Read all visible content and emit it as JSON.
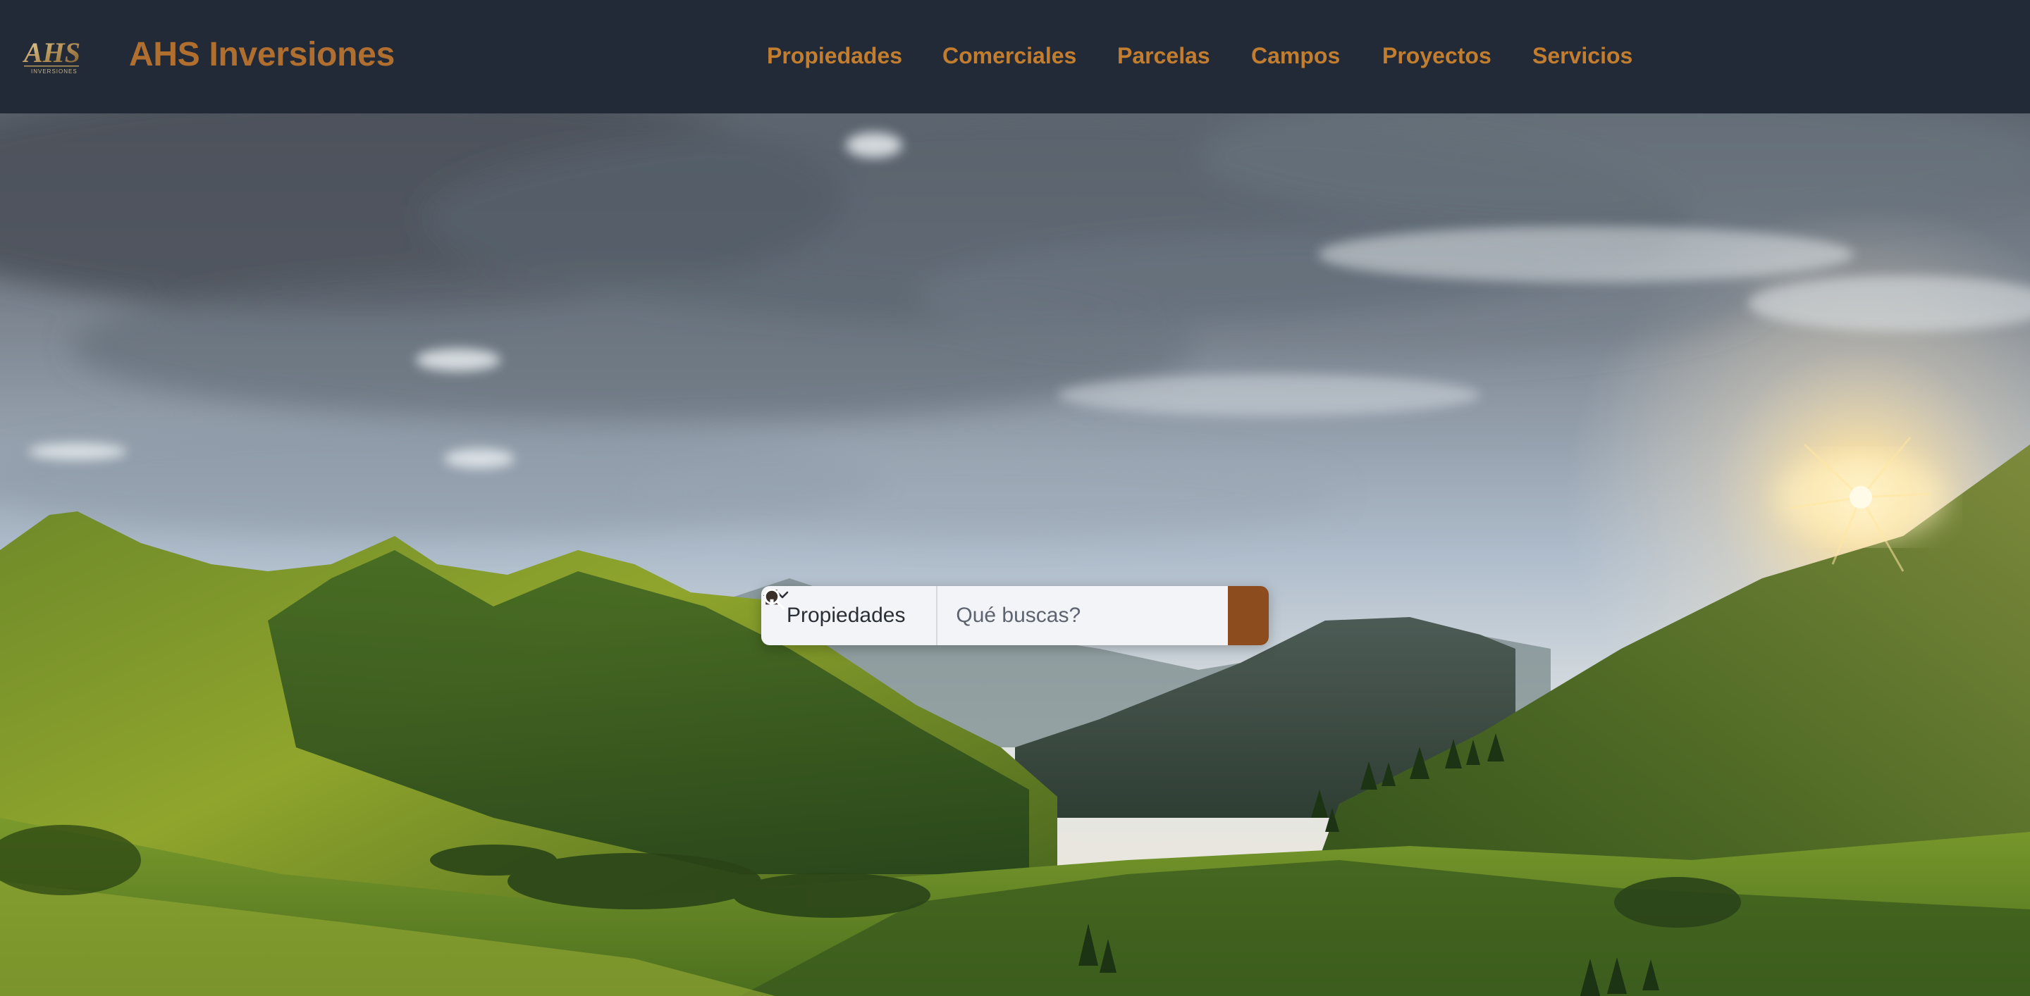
{
  "brand": {
    "logo_text": "AHS",
    "logo_subtext": "INVERSIONES",
    "name": "AHS Inversiones",
    "color": "#b06f2f"
  },
  "nav": {
    "link_color": "#c27e2e",
    "background": "#222a38",
    "links": [
      {
        "label": "Propiedades"
      },
      {
        "label": "Comerciales"
      },
      {
        "label": "Parcelas"
      },
      {
        "label": "Campos"
      },
      {
        "label": "Proyectos"
      },
      {
        "label": "Servicios"
      }
    ]
  },
  "search": {
    "select_icon": "house-icon",
    "select_value": "Propiedades",
    "input_value": "",
    "placeholder": "Qué buscas?",
    "button_icon": "search-icon",
    "button_color": "#8c4c1e"
  },
  "hero": {
    "image_subject": "mountain-valley-sunrise"
  }
}
